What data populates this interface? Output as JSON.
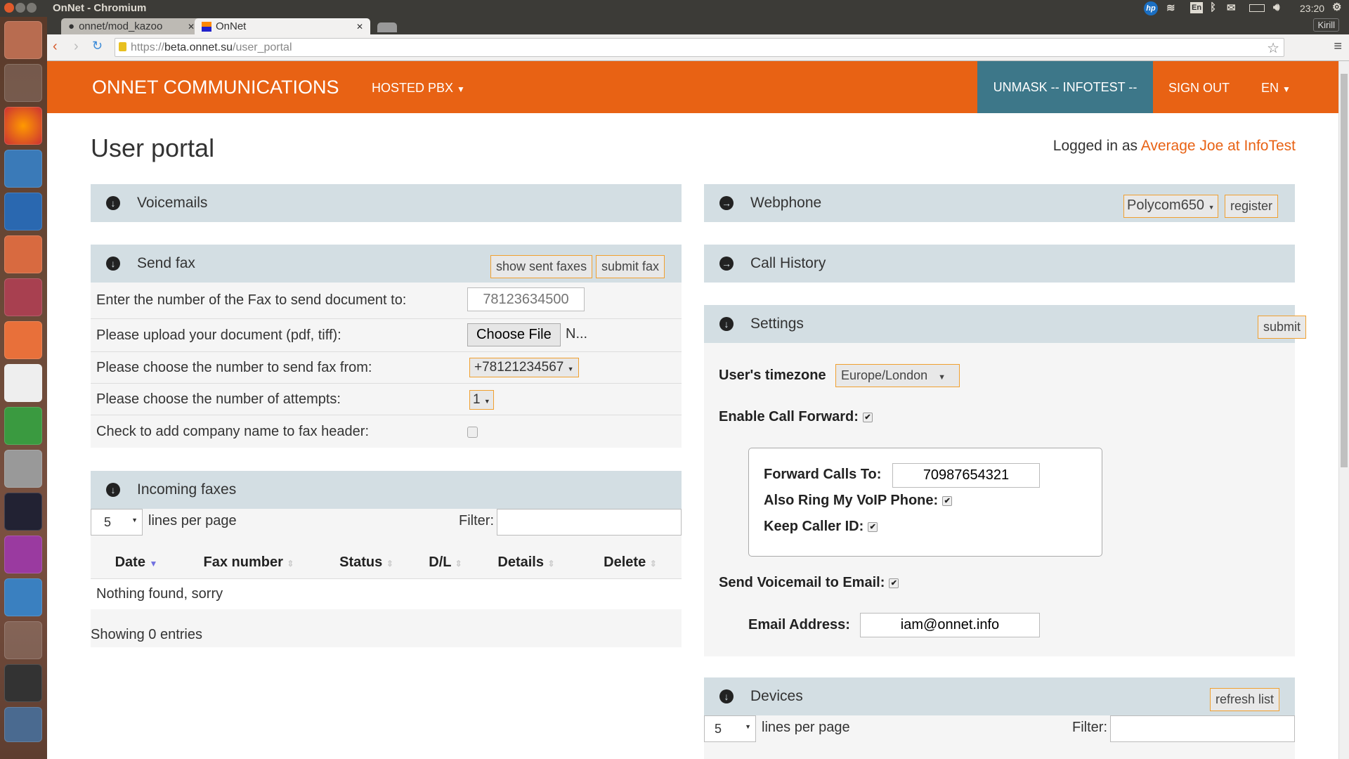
{
  "os": {
    "window_title": "OnNet - Chromium",
    "clock": "23:20",
    "user": "Kirill",
    "keyboard": "En"
  },
  "browser": {
    "tabs": [
      {
        "label": "onnet/mod_kazoo"
      },
      {
        "label": "OnNet"
      }
    ],
    "url_scheme": "https://",
    "url_host": "beta.onnet.su",
    "url_path": "/user_portal"
  },
  "nav": {
    "brand": "ONNET COMMUNICATIONS",
    "hosted_pbx": "HOSTED PBX",
    "unmask": "UNMASK -- INFOTEST --",
    "sign_out": "SIGN OUT",
    "lang": "EN",
    "accent": "#e86214",
    "unmask_color": "#3d7789"
  },
  "page": {
    "title": "User portal",
    "logged_in_prefix": "Logged in as ",
    "logged_in_user": "Average Joe at InfoTest"
  },
  "voicemails": {
    "title": "Voicemails"
  },
  "send_fax": {
    "title": "Send fax",
    "show_sent": "show sent faxes",
    "submit": "submit fax",
    "rows": [
      {
        "label": "Enter the number of the Fax to send document to:",
        "placeholder": "78123634500"
      },
      {
        "label": "Please upload your document (pdf, tiff):",
        "button": "Choose File",
        "file": "N..."
      },
      {
        "label": "Please choose the number to send fax from:",
        "value": "+78121234567"
      },
      {
        "label": "Please choose the number of attempts:",
        "value": "1"
      },
      {
        "label": "Check to add company name to fax header:",
        "checked": false
      }
    ]
  },
  "incoming": {
    "title": "Incoming faxes",
    "lines": "5",
    "lines_label": "lines per page",
    "filter": "Filter:",
    "columns": [
      "Date",
      "Fax number",
      "Status",
      "D/L",
      "Details",
      "Delete"
    ],
    "empty": "Nothing found, sorry",
    "showing": "Showing 0 entries"
  },
  "webphone": {
    "title": "Webphone",
    "device": "Polycom650",
    "register": "register"
  },
  "call_history": {
    "title": "Call History"
  },
  "settings": {
    "title": "Settings",
    "submit": "submit",
    "timezone_label": "User's timezone",
    "timezone": "Europe/London",
    "call_forward_label": "Enable Call Forward:",
    "call_forward": true,
    "forward_to_label": "Forward Calls To:",
    "forward_to": "70987654321",
    "ring_voip_label": "Also Ring My VoIP Phone:",
    "ring_voip": true,
    "keep_cid_label": "Keep Caller ID:",
    "keep_cid": true,
    "vm_email_label": "Send Voicemail to Email:",
    "vm_email": true,
    "email_label": "Email Address:",
    "email": "iam@onnet.info"
  },
  "devices": {
    "title": "Devices",
    "refresh": "refresh list",
    "lines": "5",
    "lines_label": "lines per page",
    "filter": "Filter:"
  }
}
